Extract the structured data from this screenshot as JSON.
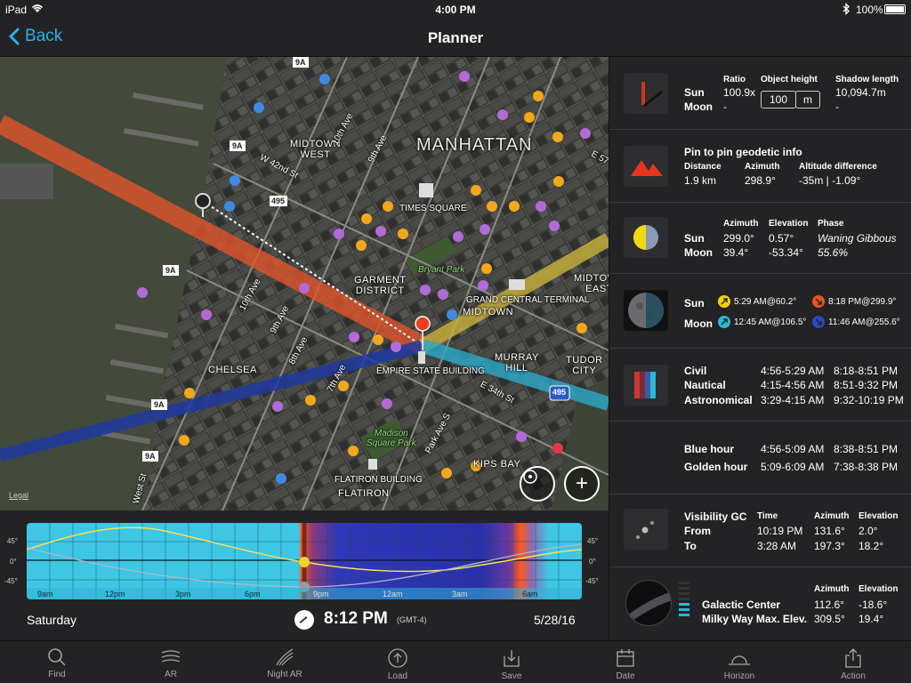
{
  "status": {
    "device": "iPad",
    "time": "4:00 PM",
    "battery": "100%"
  },
  "nav": {
    "back_label": "Back",
    "title": "Planner"
  },
  "map": {
    "labels": {
      "manhattan": "MANHATTAN",
      "midtown_west": "MIDTOWN\nWEST",
      "times_square": "TIMES SQUARE",
      "garment_district": "GARMENT\nDISTRICT",
      "bryant_park": "Bryant Park",
      "grand_central": "GRAND CENTRAL TERMINAL",
      "midtown": "MIDTOWN",
      "midtown_east": "MIDTOWN\nEAST",
      "chelsea": "CHELSEA",
      "empire_state": "EMPIRE STATE BUILDING",
      "murray_hill": "MURRAY\nHILL",
      "tudor_city": "TUDOR\nCITY",
      "e34": "E 34th St",
      "madison_sq": "Madison\nSquare Park",
      "kips_bay": "KIPS BAY",
      "flatiron_bldg": "FLATIRON BUILDING",
      "flatiron": "FLATIRON",
      "w42": "W 42nd St",
      "10th_ave": "10th Ave",
      "9th_ave_n": "9th Ave",
      "10th_ave_s": "10th Ave",
      "9th_ave_s": "9th Ave",
      "8th_ave": "8th Ave",
      "7th_ave": "7th Ave",
      "park_ave": "Park Ave S",
      "west_st": "West St",
      "9a_1": "9A",
      "9a_2": "9A",
      "9a_3": "9A",
      "9a_4": "9A",
      "9a_5": "9A",
      "r495_1": "495",
      "r495_2": "495",
      "e57": "E 57"
    },
    "legal": "Legal"
  },
  "timeline": {
    "day": "Saturday",
    "time": "8:12 PM",
    "tz": "(GMT-4)",
    "date": "5/28/16",
    "y_labels": [
      "45°",
      "0°",
      "-45°"
    ],
    "x_labels": [
      "9am",
      "12pm",
      "3pm",
      "6pm",
      "9pm",
      "12am",
      "3am",
      "6am"
    ]
  },
  "panel": {
    "shadow": {
      "sun": "Sun",
      "moon": "Moon",
      "ratio_h": "Ratio",
      "ratio_sun": "100.9x",
      "ratio_moon": "-",
      "height_h": "Object height",
      "height_value": "100",
      "height_unit": "m",
      "shadow_h": "Shadow length",
      "shadow_sun": "10,094.7m",
      "shadow_moon": "-"
    },
    "geodetic": {
      "title": "Pin to pin geodetic info",
      "distance_h": "Distance",
      "distance": "1.9 km",
      "azimuth_h": "Azimuth",
      "azimuth": "298.9°",
      "altdiff_h": "Altitude difference",
      "altdiff": "-35m | -1.09°"
    },
    "position": {
      "sun": "Sun",
      "moon": "Moon",
      "azimuth_h": "Azimuth",
      "elevation_h": "Elevation",
      "phase_h": "Phase",
      "sun_az": "299.0°",
      "sun_el": "0.57°",
      "phase": "Waning Gibbous",
      "moon_az": "39.4°",
      "moon_el": "-53.34°",
      "illum": "55.6%"
    },
    "riseset": {
      "sun": "Sun",
      "moon": "Moon",
      "sunrise": "5:29 AM@60.2°",
      "sunset": "8:18 PM@299.9°",
      "moonrise": "12:45 AM@106.5°",
      "moonset": "11:46 AM@255.6°"
    },
    "twilight": {
      "civil": "Civil",
      "nautical": "Nautical",
      "astronomical": "Astronomical",
      "civil_am": "4:56-5:29 AM",
      "civil_pm": "8:18-8:51 PM",
      "nautical_am": "4:15-4:56 AM",
      "nautical_pm": "8:51-9:32 PM",
      "astro_am": "3:29-4:15 AM",
      "astro_pm": "9:32-10:19 PM"
    },
    "hours": {
      "blue": "Blue hour",
      "blue_am": "4:56-5:09 AM",
      "blue_pm": "8:38-8:51 PM",
      "golden": "Golden hour",
      "golden_am": "5:09-6:09 AM",
      "golden_pm": "7:38-8:38 PM"
    },
    "visibility": {
      "title": "Visibility GC",
      "from": "From",
      "to": "To",
      "time_h": "Time",
      "azimuth_h": "Azimuth",
      "elevation_h": "Elevation",
      "from_time": "10:19 PM",
      "from_az": "131.6°",
      "from_el": "2.0°",
      "to_time": "3:28 AM",
      "to_az": "197.3°",
      "to_el": "18.2°"
    },
    "galactic": {
      "center": "Galactic Center",
      "max": "Milky Way Max. Elev.",
      "azimuth_h": "Azimuth",
      "elevation_h": "Elevation",
      "center_az": "112.6°",
      "center_el": "-18.6°",
      "max_az": "309.5°",
      "max_el": "19.4°"
    }
  },
  "tabs": [
    "Find",
    "AR",
    "Night AR",
    "Load",
    "Save",
    "Date",
    "Horizon",
    "Action"
  ],
  "colors": {
    "accent": "#27b3e8",
    "sun_line": "#e0542a",
    "moon_line": "#1f3aa0",
    "sunrise_line": "#c9b23a",
    "moonrise_line": "#2aa9c8"
  }
}
